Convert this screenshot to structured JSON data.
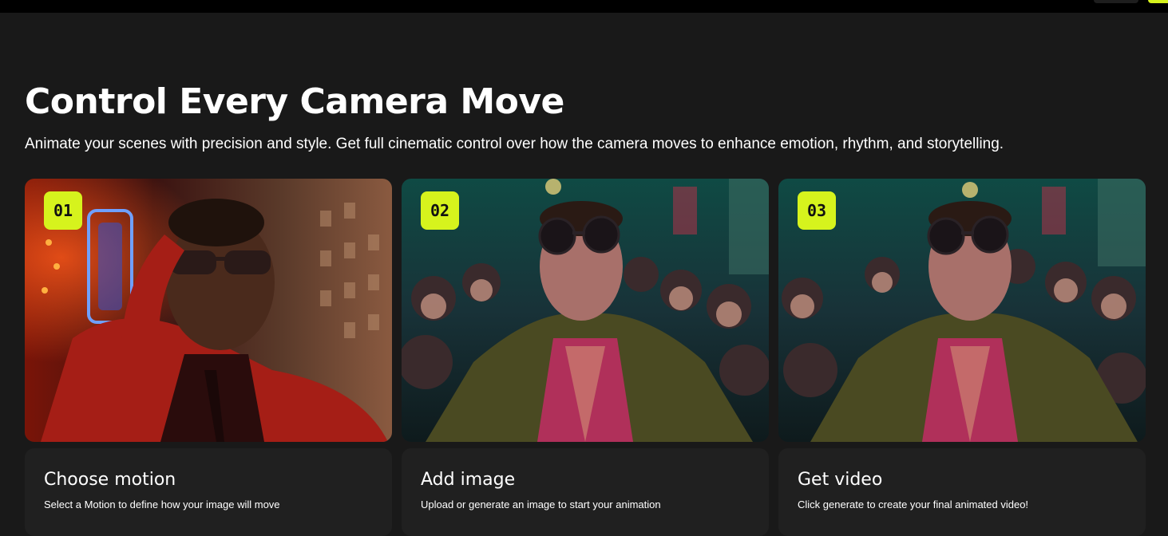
{
  "section": {
    "title": "Control Every Camera Move",
    "subtitle": "Animate your scenes with precision and style. Get full cinematic control over how the camera moves to enhance emotion, rhythm, and storytelling."
  },
  "colors": {
    "background": "#191919",
    "card_background": "#202020",
    "accent": "#d6f31d"
  },
  "steps": [
    {
      "number": "01",
      "title": "Choose motion",
      "description": "Select a Motion to define how your image will move",
      "image_icon": "portrait-image-icon"
    },
    {
      "number": "02",
      "title": "Add image",
      "description": "Upload or generate an image to start your animation",
      "image_icon": "crowd-image-icon"
    },
    {
      "number": "03",
      "title": "Get video",
      "description": "Click generate to create your final animated video!",
      "image_icon": "crowd-image-icon"
    }
  ]
}
